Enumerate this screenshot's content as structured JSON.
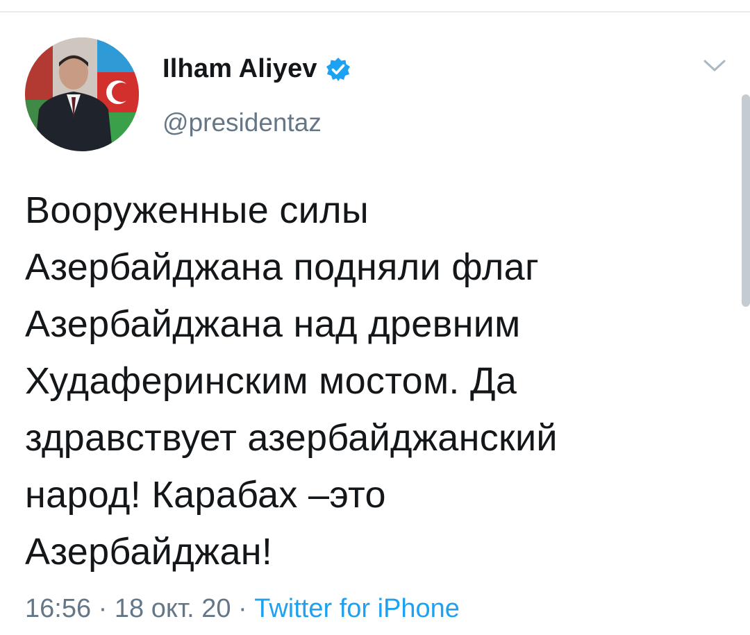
{
  "tweet": {
    "display_name": "Ilham Aliyev",
    "handle": "@presidentaz",
    "verified": true,
    "text_lines": [
      "Вооруженные силы",
      "Азербайджана подняли  флаг",
      "Азербайджана над древним",
      "Худаферинским мостом. Да",
      "здравствует азербайджанский",
      "народ! Карабах –это",
      "Азербайджан!"
    ],
    "time": "16:56",
    "separator": "·",
    "date": "18 окт. 20",
    "source": "Twitter for iPhone"
  },
  "icons": {
    "verified": "verified-badge-icon",
    "menu": "chevron-down-icon"
  },
  "colors": {
    "text": "#14171a",
    "secondary": "#657786",
    "accent": "#1da1f2",
    "divider": "#e6ecf0"
  }
}
